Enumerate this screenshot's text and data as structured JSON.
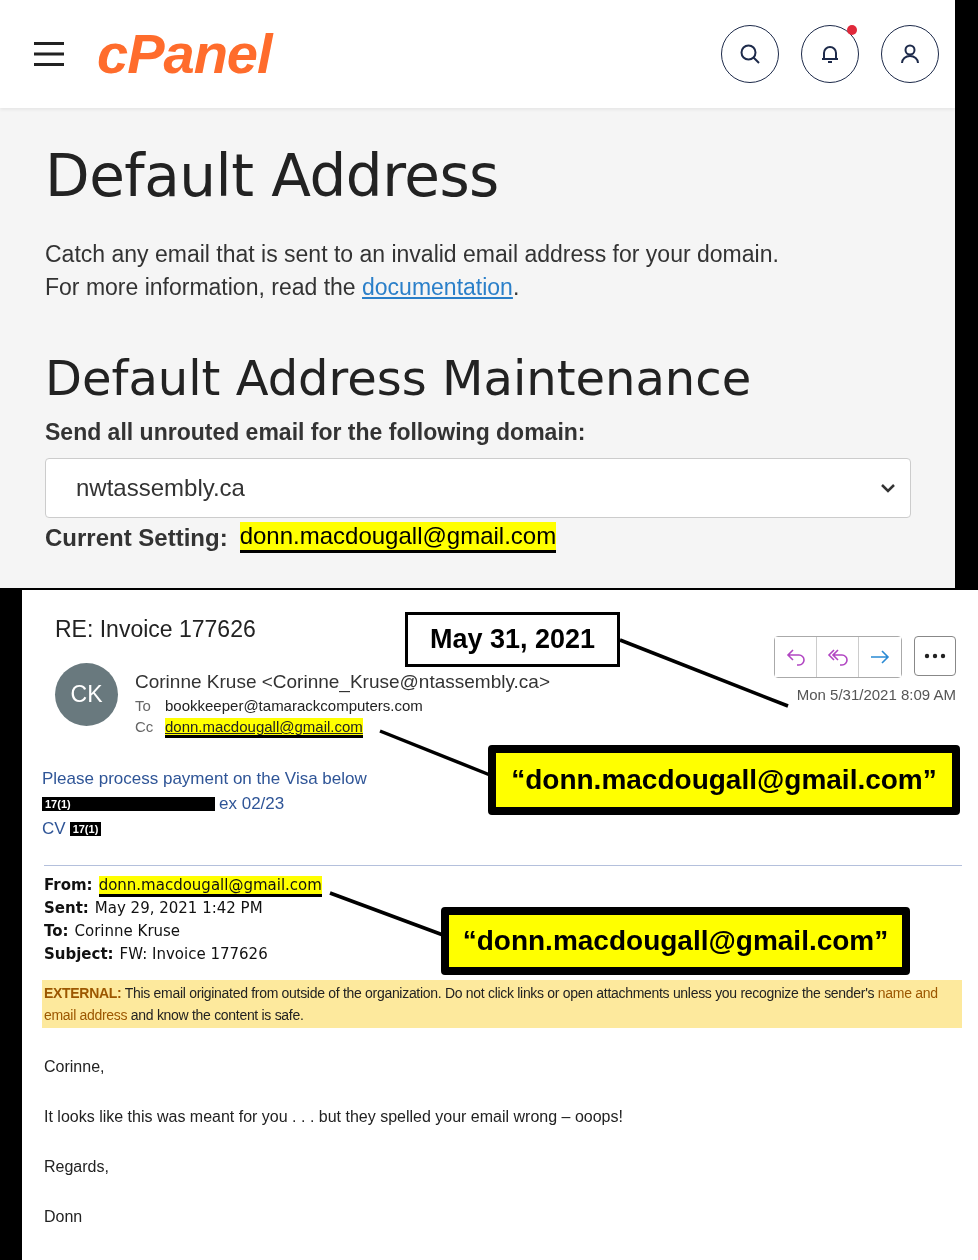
{
  "header": {
    "logo": "cPanel",
    "notification": true
  },
  "cpanel": {
    "title": "Default Address",
    "description_line1": "Catch any email that is sent to an invalid email address for your domain.",
    "description_line2": "For more information, read the ",
    "link": "documentation",
    "link_after": ".",
    "section_title": "Default Address Maintenance",
    "domain_label": "Send all unrouted email for the following domain:",
    "domain_value": "nwtassembly.ca",
    "current_label": "Current Setting:",
    "current_value": "donn.macdougall@gmail.com",
    "current_highlighted": true
  },
  "email": {
    "subject": "RE: Invoice 177626",
    "avatar": "CK",
    "sender": "Corinne Kruse <Corinne_Kruse@ntassembly.ca>",
    "to_label": "To",
    "to": "bookkeeper@tamarackcomputers.com",
    "cc_label": "Cc",
    "cc": "donn.macdougall@gmail.com",
    "cc_highlighted": true,
    "date": "Mon 5/31/2021 8:09 AM",
    "body_line1": "Please process payment on the Visa below",
    "redaction1": "17(1)",
    "expiry": "ex 02/23",
    "cv_label": "CV",
    "redaction2": "17(1)",
    "quoted": [
      {
        "label": "From:",
        "value": "donn.macdougall@gmail.com",
        "highlighted": true
      },
      {
        "label": "Sent:",
        "value": "May 29, 2021 1:42 PM",
        "highlighted": false
      },
      {
        "label": "To:",
        "value": "Corinne Kruse",
        "highlighted": false
      },
      {
        "label": "Subject:",
        "value": "FW: Invoice 177626",
        "highlighted": false
      }
    ],
    "notice": [
      {
        "kind": "label",
        "text": "EXTERNAL:"
      },
      {
        "kind": "plain",
        "text": " This email originated from outside of the organization. Do not click links or open attachments unless you recognize the sender's "
      },
      {
        "kind": "accent",
        "text": "name and email address"
      },
      {
        "kind": "plain",
        "text": " and know the content is safe."
      }
    ],
    "paragraphs": [
      "Corinne,",
      "It looks like this was meant for you . . . but they spelled your email wrong – ooops!",
      "Regards,",
      "Donn"
    ]
  },
  "annotations": [
    {
      "kind": "date",
      "text": "May 31, 2021"
    },
    {
      "kind": "callout",
      "text": "“donn.macdougall@gmail.com”"
    },
    {
      "kind": "callout",
      "text": "“donn.macdougall@gmail.com”"
    }
  ]
}
